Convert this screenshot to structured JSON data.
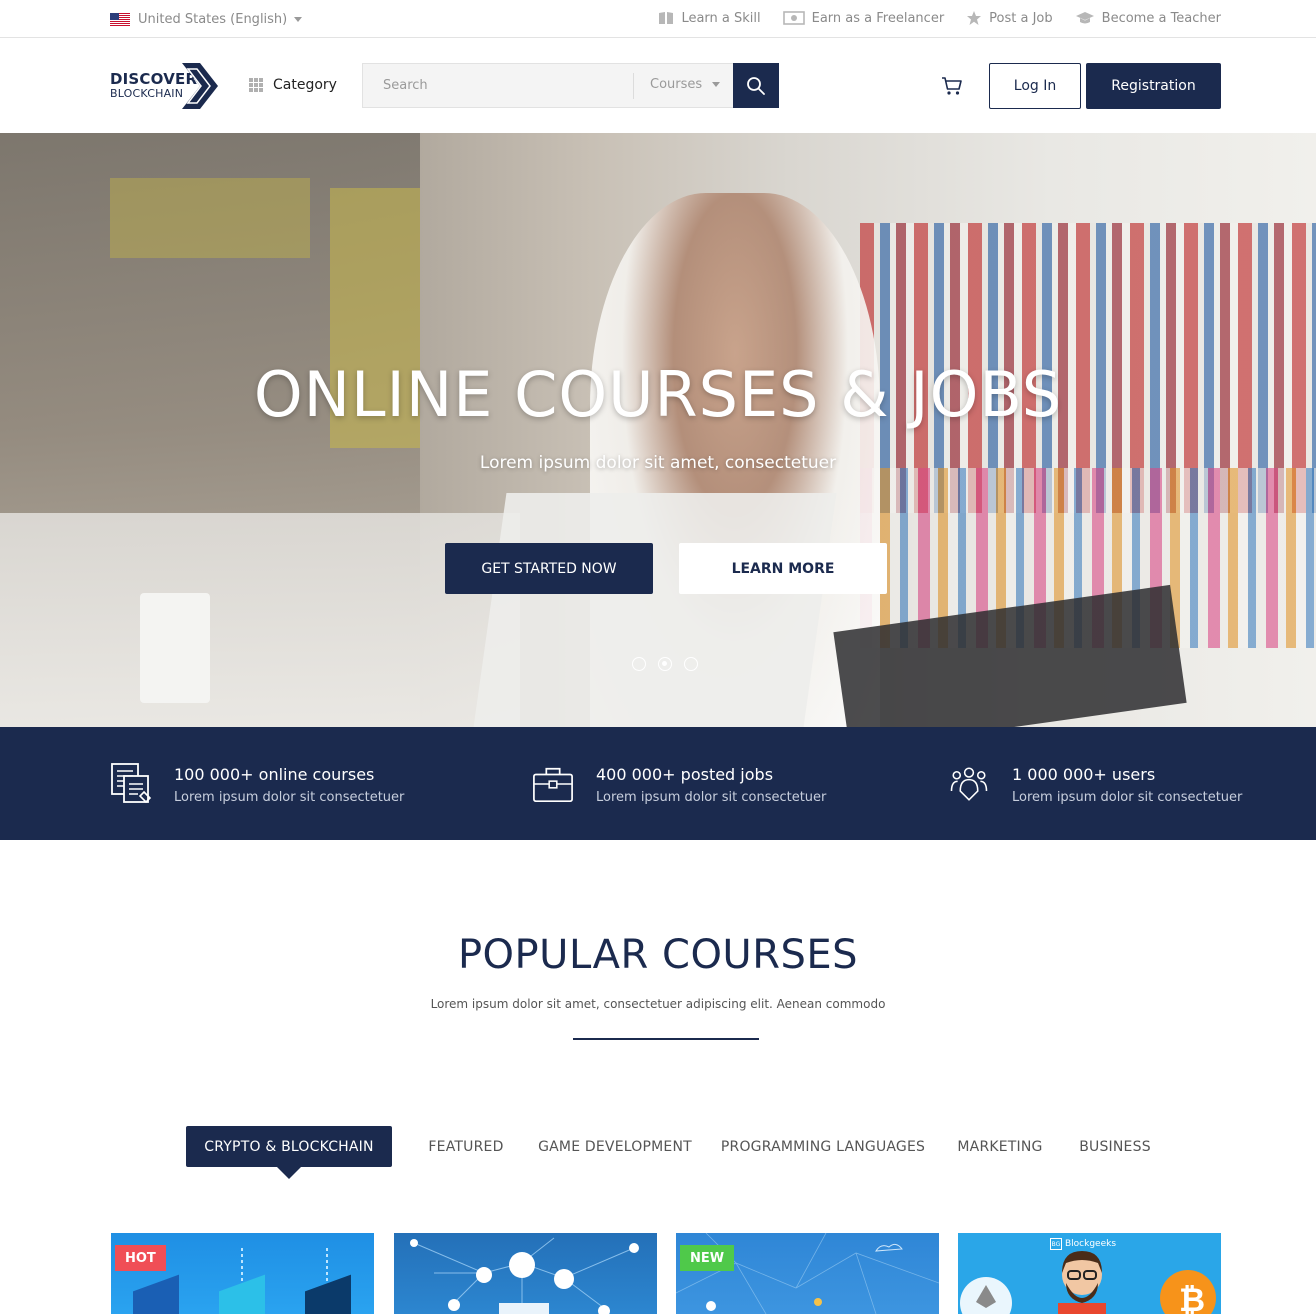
{
  "topbar": {
    "locale": "United States (English)",
    "links": [
      {
        "label": "Learn a Skill",
        "icon": "book-icon"
      },
      {
        "label": "Earn as a Freelancer",
        "icon": "money-icon"
      },
      {
        "label": "Post a Job",
        "icon": "star-icon"
      },
      {
        "label": "Become a Teacher",
        "icon": "graduation-cap-icon"
      }
    ]
  },
  "header": {
    "logo_top": "DISCOVER",
    "logo_bottom": "BLOCKCHAIN",
    "category_label": "Category",
    "search_placeholder": "Search",
    "search_scope": "Courses",
    "login_label": "Log In",
    "registration_label": "Registration"
  },
  "hero": {
    "title": "ONLINE COURSES & JOBS",
    "subtitle": "Lorem ipsum dolor sit amet, consectetuer",
    "primary_button": "GET STARTED NOW",
    "secondary_button": "LEARN MORE",
    "slides": 3,
    "active_slide": 2
  },
  "stats": [
    {
      "title": "100 000+ online courses",
      "text": "Lorem ipsum dolor sit consectetuer",
      "icon": "courses-icon"
    },
    {
      "title": "400 000+  posted jobs",
      "text": "Lorem ipsum dolor sit consectetuer",
      "icon": "briefcase-icon"
    },
    {
      "title": "1 000 000+ users",
      "text": "Lorem ipsum dolor sit consectetuer",
      "icon": "users-icon"
    }
  ],
  "popular": {
    "title": "POPULAR COURSES",
    "subtitle": "Lorem ipsum dolor sit amet, consectetuer adipiscing elit. Aenean commodo",
    "tabs": [
      "CRYPTO & BLOCKCHAIN",
      "FEATURED",
      "GAME DEVELOPMENT",
      "PROGRAMMING LANGUAGES",
      "MARKETING",
      "BUSINESS"
    ],
    "active_tab": 0
  },
  "cards": [
    {
      "badge": "HOT"
    },
    {
      "badge": ""
    },
    {
      "badge": "NEW"
    },
    {
      "badge": "",
      "brand": "Blockgeeks"
    }
  ],
  "colors": {
    "primary": "#1b2a4e",
    "hot": "#f04e56",
    "new": "#4fc94a"
  }
}
